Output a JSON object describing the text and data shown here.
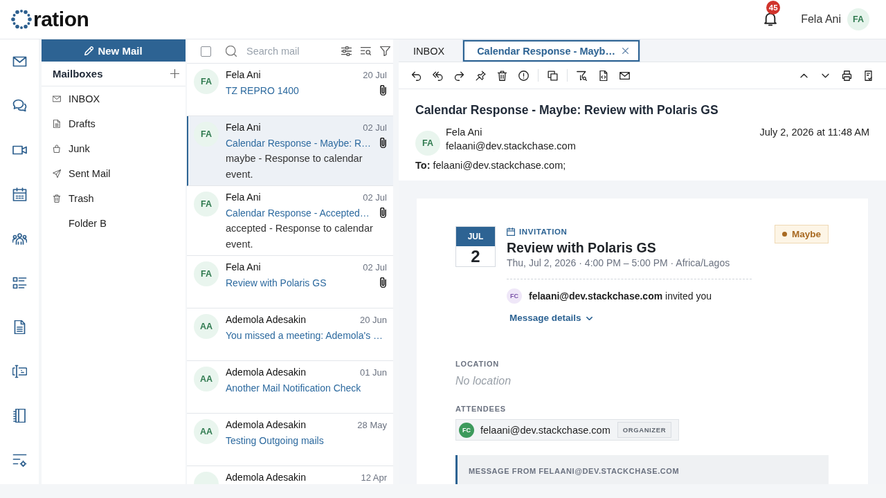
{
  "header": {
    "logo_text": "ration",
    "notification_count": "45",
    "user": {
      "name": "Fela Ani",
      "initials": "FA"
    }
  },
  "mailboxes": {
    "new_mail": "New Mail",
    "title": "Mailboxes",
    "folders": [
      {
        "label": "INBOX",
        "kind": "inbox"
      },
      {
        "label": "Drafts",
        "kind": "drafts"
      },
      {
        "label": "Junk",
        "kind": "junk"
      },
      {
        "label": "Sent Mail",
        "kind": "sent"
      },
      {
        "label": "Trash",
        "kind": "trash"
      },
      {
        "label": "Folder B",
        "kind": "custom"
      }
    ]
  },
  "message_list": {
    "select_all": {
      "checked": false
    },
    "search": {
      "placeholder": "Search mail"
    },
    "messages": [
      {
        "initials": "FA",
        "sender": "Fela Ani",
        "date": "20 Jul",
        "subject": "TZ REPRO 1400",
        "attachment": true,
        "selected": false
      },
      {
        "initials": "FA",
        "sender": "Fela Ani",
        "date": "02 Jul",
        "subject": "Calendar Response - Maybe: R…",
        "preview": "maybe - Response to calendar event.",
        "attachment": true,
        "selected": true
      },
      {
        "initials": "FA",
        "sender": "Fela Ani",
        "date": "02 Jul",
        "subject": "Calendar Response - Accepted…",
        "preview": "accepted - Response to calendar event.",
        "attachment": true,
        "selected": false
      },
      {
        "initials": "FA",
        "sender": "Fela Ani",
        "date": "02 Jul",
        "subject": "Review with Polaris GS",
        "attachment": true,
        "selected": false
      },
      {
        "initials": "AA",
        "sender": "Ademola Adesakin",
        "date": "20 Jun",
        "subject": "You missed a meeting: Ademola's …",
        "attachment": false,
        "selected": false
      },
      {
        "initials": "AA",
        "sender": "Ademola Adesakin",
        "date": "01 Jun",
        "subject": "Another Mail Notification Check",
        "attachment": false,
        "selected": false
      },
      {
        "initials": "AA",
        "sender": "Ademola Adesakin",
        "date": "28 May",
        "subject": "Testing Outgoing mails",
        "attachment": false,
        "selected": false
      },
      {
        "sender": "Ademola Adesakin",
        "date": "12 Apr",
        "attachment": false,
        "selected": false
      }
    ]
  },
  "reader": {
    "tabs": [
      {
        "label": "INBOX",
        "selected": false,
        "closable": false
      },
      {
        "label": "Calendar Response - Mayb…",
        "selected": true,
        "closable": true
      }
    ],
    "subject": "Calendar Response - Maybe: Review with Polaris GS",
    "sender": {
      "initials": "FA",
      "name": "Fela Ani",
      "email": "felaani@dev.stackchase.com"
    },
    "date": "July 2, 2026 at 11:48 AM",
    "to": "**To:** felaani@dev.stackchase.com;",
    "invitation": {
      "month": "JUL",
      "day": "2",
      "label": "INVITATION",
      "title": "Review with Polaris GS",
      "when": "Thu, Jul 2, 2026 · 4:00 PM – 5:00 PM · Africa/Lagos",
      "status": {
        "label": "Maybe",
        "kind": "maybe"
      },
      "inviter": {
        "initials": "FC",
        "text": "**felaani@dev.stackchase.com** invited you"
      },
      "details_link": "Message details",
      "location": {
        "label": "LOCATION",
        "value": "No location"
      },
      "attendees": {
        "label": "ATTENDEES",
        "items": [
          {
            "initials": "FC",
            "email": "felaani@dev.stackchase.com",
            "role": "ORGANIZER"
          }
        ]
      },
      "message_from": "MESSAGE FROM FELAANI@DEV.STACKCHASE.COM"
    }
  }
}
